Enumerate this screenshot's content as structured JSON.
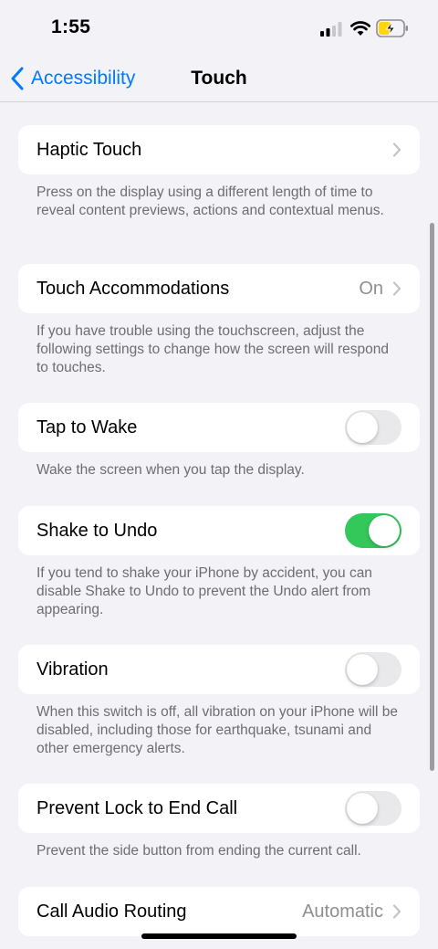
{
  "status_bar": {
    "time": "1:55"
  },
  "nav": {
    "back_label": "Accessibility",
    "title": "Touch"
  },
  "sections": [
    {
      "label": "Haptic Touch",
      "type": "chevron",
      "value": "",
      "footer": "Press on the display using a different length of time to reveal content previews, actions and contextual menus."
    },
    {
      "label": "Touch Accommodations",
      "type": "chevron",
      "value": "On",
      "footer": "If you have trouble using the touchscreen, adjust the following settings to change how the screen will respond to touches."
    },
    {
      "label": "Tap to Wake",
      "type": "toggle",
      "on": false,
      "footer": "Wake the screen when you tap the display."
    },
    {
      "label": "Shake to Undo",
      "type": "toggle",
      "on": true,
      "footer": "If you tend to shake your iPhone by accident, you can disable Shake to Undo to prevent the Undo alert from appearing."
    },
    {
      "label": "Vibration",
      "type": "toggle",
      "on": false,
      "footer": "When this switch is off, all vibration on your iPhone will be disabled, including those for earthquake, tsunami and other emergency alerts."
    },
    {
      "label": "Prevent Lock to End Call",
      "type": "toggle",
      "on": false,
      "footer": "Prevent the side button from ending the current call."
    },
    {
      "label": "Call Audio Routing",
      "type": "chevron",
      "value": "Automatic",
      "footer": ""
    }
  ],
  "colors": {
    "accent": "#007aff",
    "toggle_on": "#34c759",
    "toggle_off": "#e9e9eb",
    "background": "#f2f2f7"
  }
}
